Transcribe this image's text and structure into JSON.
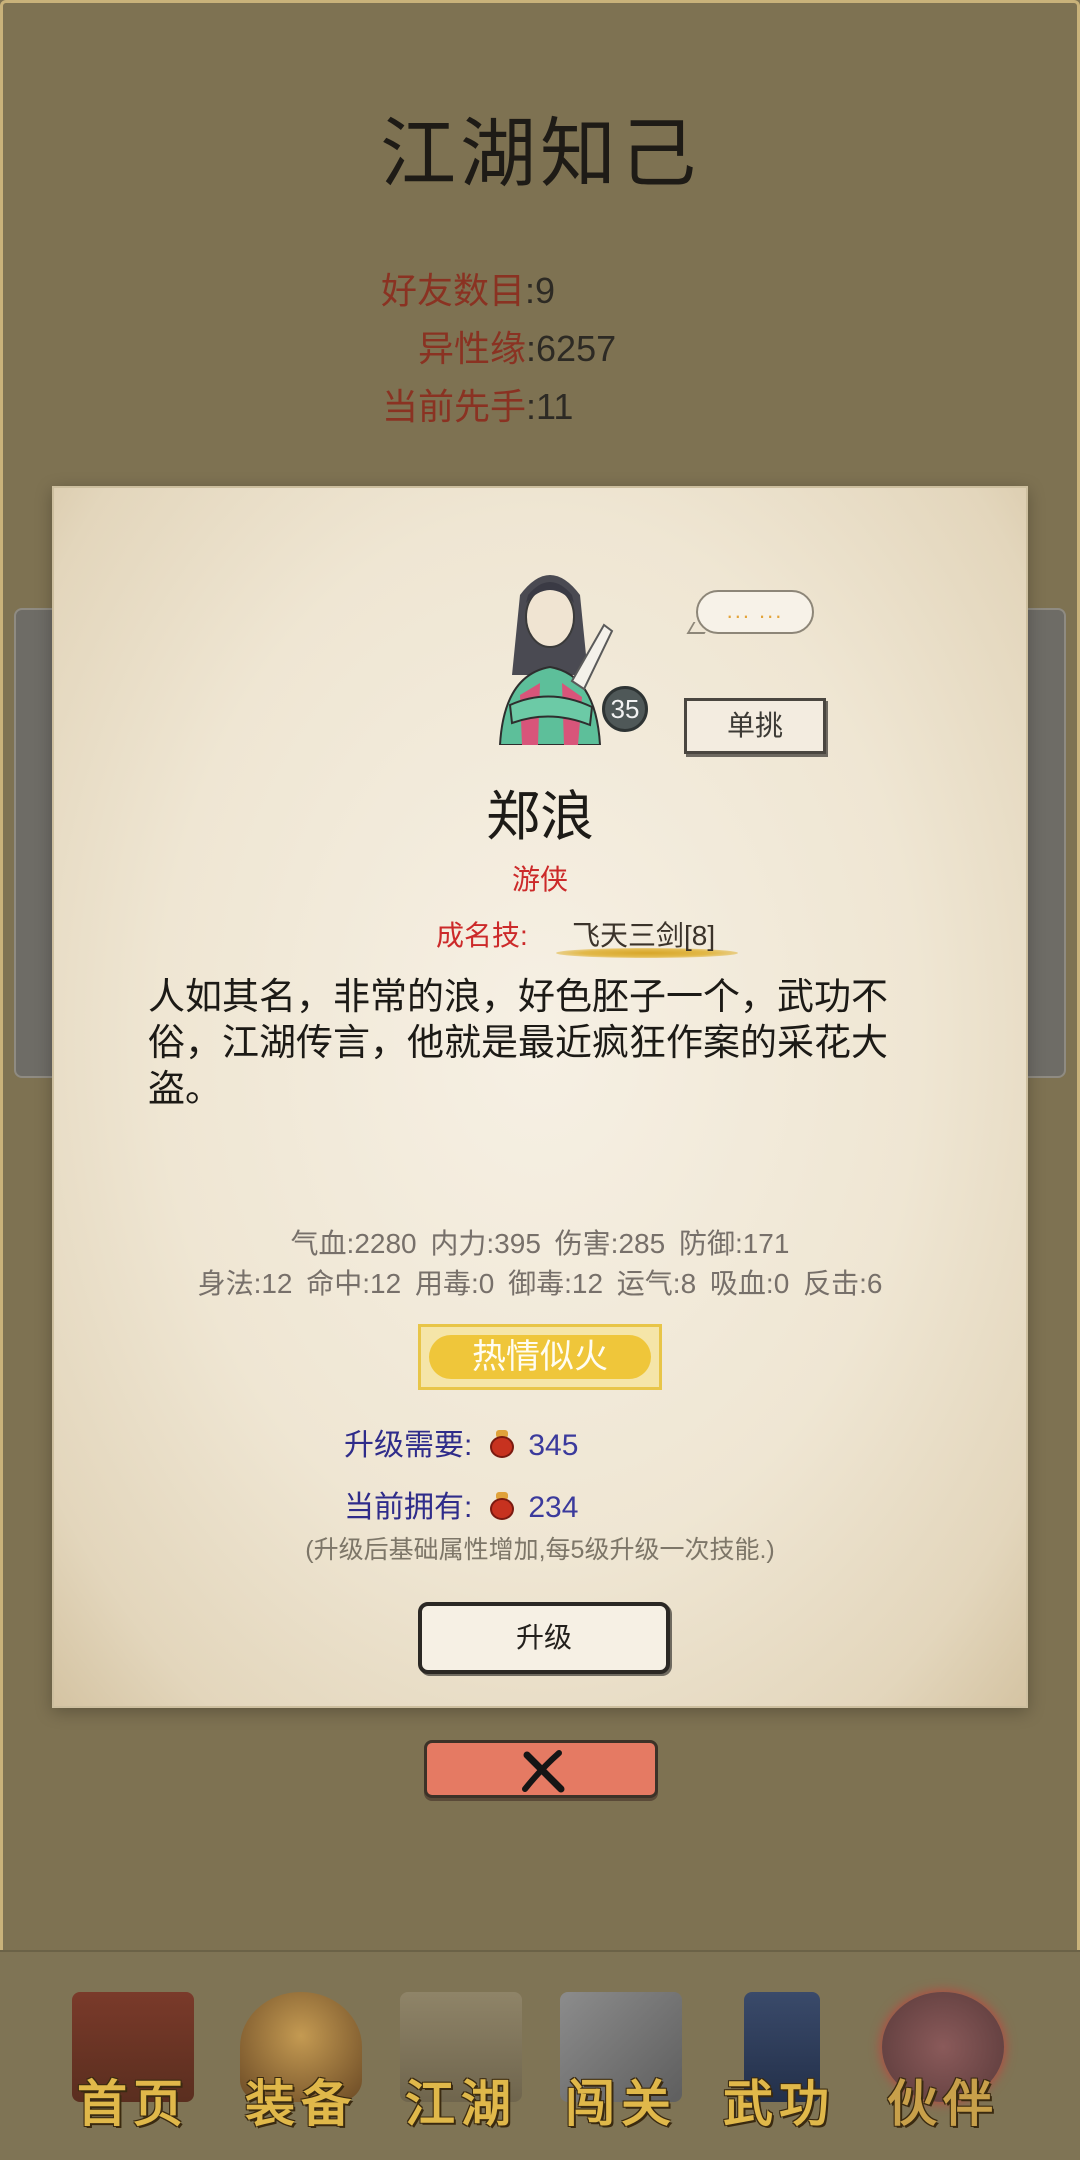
{
  "page": {
    "title": "江湖知己"
  },
  "summary": [
    {
      "label": "好友数目",
      "value": "9"
    },
    {
      "label": "异性缘",
      "value": "6257"
    },
    {
      "label": "当前先手",
      "value": "11"
    }
  ],
  "card": {
    "level": "35",
    "speech": "... ...",
    "duel_label": "单挑",
    "name": "郑浪",
    "class": "游侠",
    "signature_label": "成名技:",
    "signature_skill": "飞天三剑[8]",
    "description": "人如其名，非常的浪，好色胚子一个，武功不俗，江湖传言，他就是最近疯狂作案的采花大盗。",
    "attributes_line1": "气血:2280  内力:395  伤害:285  防御:171",
    "attributes_line2": "身法:12  命中:12  用毒:0  御毒:12  运气:8  吸血:0  反击:6",
    "trait": "热情似火",
    "upgrade_need_label": "升级需要:",
    "upgrade_need_value": "345",
    "current_own_label": "当前拥有:",
    "current_own_value": "234",
    "hint": "(升级后基础属性增加,每5级升级一次技能.)",
    "upgrade_label": "升级"
  },
  "nav": [
    {
      "label": "首页",
      "icon": "house-icon"
    },
    {
      "label": "装备",
      "icon": "armor-icon"
    },
    {
      "label": "江湖",
      "icon": "scroll-map-icon"
    },
    {
      "label": "闯关",
      "icon": "crossed-swords-icon"
    },
    {
      "label": "武功",
      "icon": "book-icon"
    },
    {
      "label": "伙伴",
      "icon": "partners-icon"
    }
  ],
  "colors": {
    "background": "#7e7252",
    "label_red": "#8a3222",
    "accent_red": "#cc2a2a",
    "trait_gold": "#efc63a",
    "cost_blue": "#2f2c8a",
    "close_button": "#e57a63"
  }
}
